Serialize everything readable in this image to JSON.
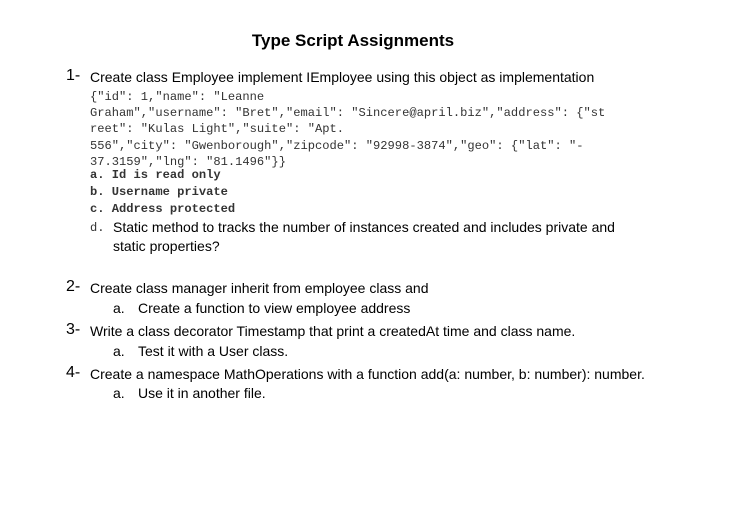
{
  "title": "Type Script Assignments",
  "q1": {
    "number": "1-",
    "text": "Create class Employee implement IEmployee using this object as implementation",
    "code_lines": [
      "{\"id\": 1,\"name\": \"Leanne",
      "Graham\",\"username\": \"Bret\",\"email\": \"Sincere@april.biz\",\"address\": {\"st",
      "reet\": \"Kulas Light\",\"suite\": \"Apt.",
      "556\",\"city\": \"Gwenborough\",\"zipcode\": \"92998-3874\",\"geo\": {\"lat\": \"-",
      "37.3159\",\"lng\": \"81.1496\"}}"
    ],
    "sub": [
      {
        "letter": "a.",
        "text": "Id is read only"
      },
      {
        "letter": "b.",
        "text": "Username private"
      },
      {
        "letter": "c.",
        "text": "Address protected"
      }
    ],
    "sub_d_letter": "d.",
    "sub_d_line1": "Static method to tracks the number of instances created and includes private and",
    "sub_d_line2": "static properties?"
  },
  "q2": {
    "number": "2-",
    "text": "Create class manager inherit from employee class and",
    "sub_letter": "a.",
    "sub_text": "Create a function to view employee address"
  },
  "q3": {
    "number": "3-",
    "text": "Write a class decorator Timestamp that print a createdAt  time and class name.",
    "sub_letter": "a.",
    "sub_text": "Test it with a User class."
  },
  "q4": {
    "number": "4-",
    "text": "Create a namespace MathOperations with a function add(a: number, b: number): number.",
    "sub_letter": "a.",
    "sub_text": "Use it in another file."
  }
}
